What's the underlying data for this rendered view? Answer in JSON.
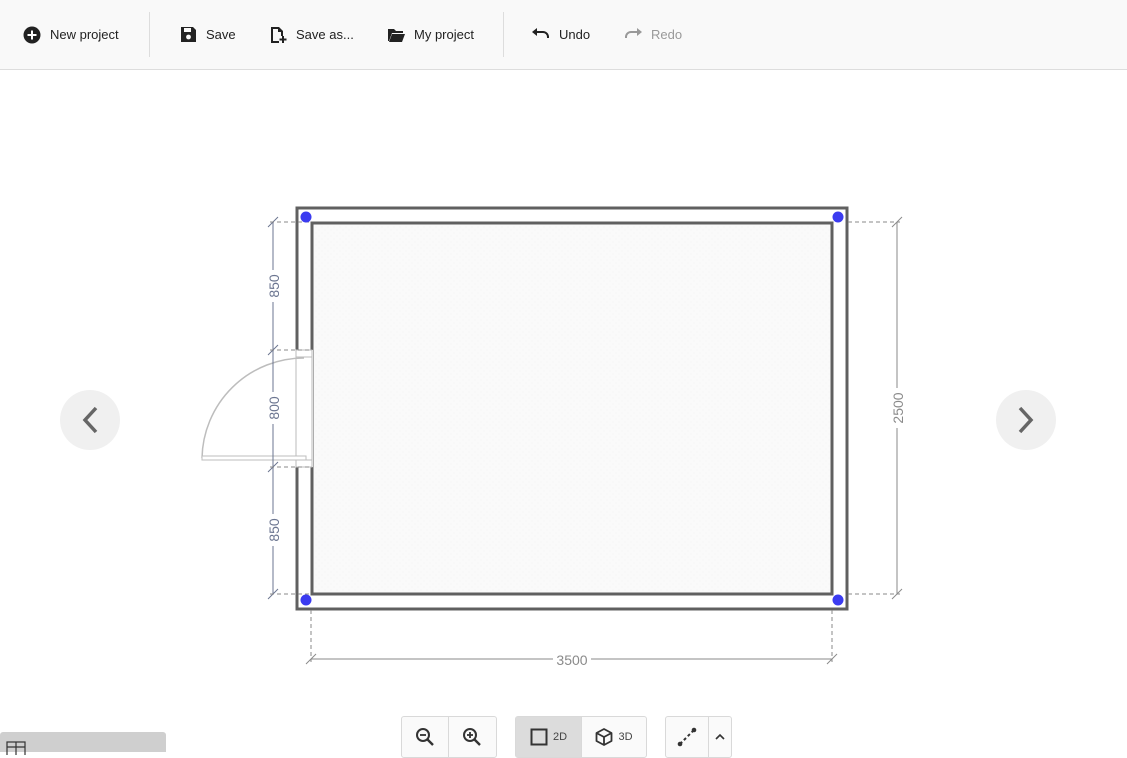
{
  "toolbar": {
    "new_project": "New project",
    "save": "Save",
    "save_as": "Save as...",
    "my_project": "My project",
    "undo": "Undo",
    "redo": "Redo"
  },
  "plan": {
    "dim_left_top": "850",
    "dim_left_mid": "800",
    "dim_left_bottom": "850",
    "dim_right": "2500",
    "dim_bottom": "3500"
  },
  "view": {
    "mode_2d": "2D",
    "mode_3d": "3D",
    "active_mode": "2D"
  },
  "colors": {
    "vertex": "#3b3bf0",
    "wall": "#606060",
    "dimension": "#8a8a8a",
    "dimension_left": "#6b7590"
  },
  "icons": {
    "new_project": "plus-circle-icon",
    "save": "floppy-icon",
    "save_as": "file-plus-icon",
    "my_project": "folder-open-icon",
    "undo": "undo-icon",
    "redo": "redo-icon",
    "zoom_out": "zoom-out-icon",
    "zoom_in": "zoom-in-icon",
    "draw_wall": "draw-wall-icon"
  }
}
